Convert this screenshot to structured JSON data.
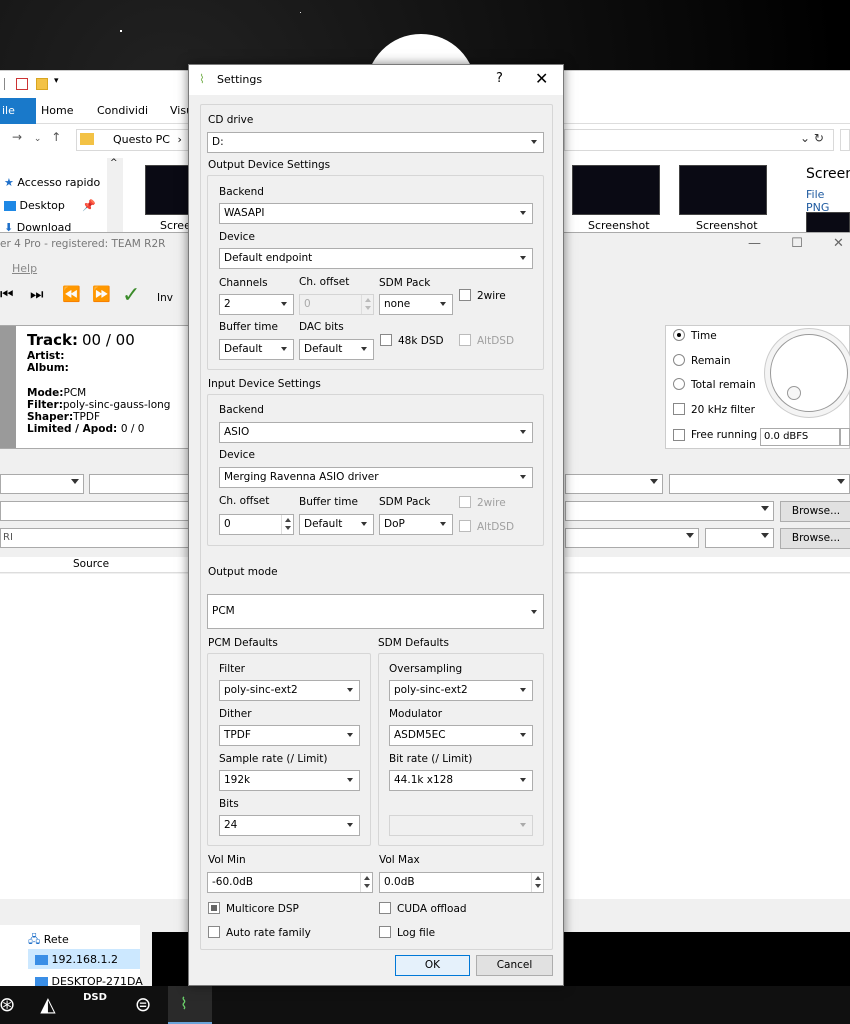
{
  "explorer": {
    "tabs": [
      "ile",
      "Home",
      "Condividi",
      "Visu"
    ],
    "address": "Questo PC",
    "nav_items": [
      "Accesso rapido",
      "Desktop",
      "Download"
    ],
    "thumbs": [
      "Scree",
      "Screenshot",
      "Screenshot"
    ],
    "right_title": "Screen",
    "right_sub": "File PNG"
  },
  "player": {
    "title": "er 4 Pro - registered: TEAM R2R",
    "menu_help": "Help",
    "inv_label": "Inv",
    "track_label": "Track:",
    "track_value": "00 / 00",
    "artist_label": "Artist:",
    "album_label": "Album:",
    "mode_label": "Mode:",
    "mode_value": "PCM",
    "filter_label": "Filter:",
    "filter_value": "poly-sinc-gauss-long",
    "shaper_label": "Shaper:",
    "shaper_value": "TPDF",
    "limited_label": "Limited / Apod:",
    "limited_value": "0 / 0",
    "radio_time": "Time",
    "radio_remain": "Remain",
    "radio_total_remain": "Total remain",
    "chk_20khz": "20 kHz filter",
    "chk_free_running": "Free running",
    "volume": "0.0 dBFS",
    "browse1": "Browse...",
    "browse2": "Browse...",
    "ri_text": "RI",
    "source_header": "Source",
    "rete": "Rete",
    "ip": "192.168.1.2",
    "desktop_pc": "DESKTOP-271DA"
  },
  "taskbar": {
    "dsd_label": "DSD"
  },
  "settings": {
    "title": "Settings",
    "help": "?",
    "close": "✕",
    "cd_drive_label": "CD drive",
    "cd_drive_value": "D:",
    "output_group": "Output Device Settings",
    "out_backend_label": "Backend",
    "out_backend_value": "WASAPI",
    "out_device_label": "Device",
    "out_device_value": "Default endpoint",
    "channels_label": "Channels",
    "channels_value": "2",
    "ch_offset_label": "Ch. offset",
    "ch_offset_value": "0",
    "sdm_pack_label": "SDM Pack",
    "sdm_pack_value": "none",
    "twowire_label": "2wire",
    "buffer_time_label": "Buffer time",
    "buffer_time_value": "Default",
    "dac_bits_label": "DAC bits",
    "dac_bits_value": "Default",
    "dsd48k_label": "48k DSD",
    "altdsd_label": "AltDSD",
    "input_group": "Input Device Settings",
    "in_backend_label": "Backend",
    "in_backend_value": "ASIO",
    "in_device_label": "Device",
    "in_device_value": "Merging Ravenna ASIO driver",
    "in_ch_offset_label": "Ch. offset",
    "in_ch_offset_value": "0",
    "in_buffer_time_label": "Buffer time",
    "in_buffer_time_value": "Default",
    "in_sdm_pack_label": "SDM Pack",
    "in_sdm_pack_value": "DoP",
    "in_twowire_label": "2wire",
    "in_altdsd_label": "AltDSD",
    "output_mode_label": "Output mode",
    "output_mode_value": "PCM",
    "pcm_defaults": "PCM Defaults",
    "sdm_defaults": "SDM Defaults",
    "filter_label": "Filter",
    "filter_value": "poly-sinc-ext2",
    "dither_label": "Dither",
    "dither_value": "TPDF",
    "sample_rate_label": "Sample rate (/ Limit)",
    "sample_rate_value": "192k",
    "bits_label": "Bits",
    "bits_value": "24",
    "oversampling_label": "Oversampling",
    "oversampling_value": "poly-sinc-ext2",
    "modulator_label": "Modulator",
    "modulator_value": "ASDM5EC",
    "bit_rate_label": "Bit rate (/ Limit)",
    "bit_rate_value": "44.1k x128",
    "vol_min_label": "Vol Min",
    "vol_min_value": "-60.0dB",
    "vol_max_label": "Vol Max",
    "vol_max_value": "0.0dB",
    "multicore_label": "Multicore DSP",
    "cuda_label": "CUDA offload",
    "auto_rate_label": "Auto rate family",
    "log_file_label": "Log file",
    "ok": "OK",
    "cancel": "Cancel"
  }
}
